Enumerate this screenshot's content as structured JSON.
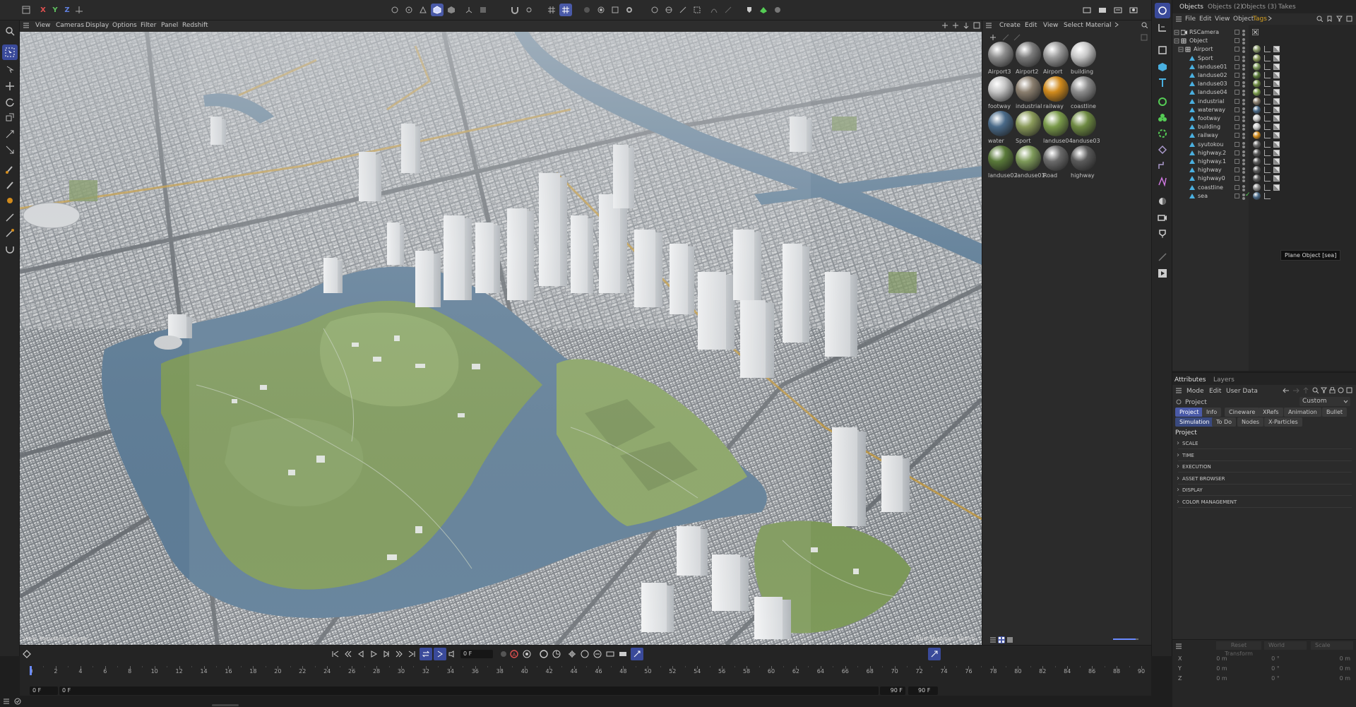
{
  "topbar": {
    "axis_x": "X",
    "axis_y": "Y",
    "axis_z": "Z"
  },
  "viewport": {
    "menu": [
      "View",
      "Cameras",
      "Display",
      "Options",
      "Filter",
      "Panel",
      "Redshift"
    ],
    "label": "View Transform: Scene",
    "grid_spacing": "Grid Spacing : 500 m"
  },
  "material_manager": {
    "menu": [
      "Create",
      "Edit",
      "View",
      "Select",
      "Material"
    ],
    "materials": [
      {
        "name": "Airport3",
        "color": "#8e8e8e"
      },
      {
        "name": "Airport2",
        "color": "#7c7c7c"
      },
      {
        "name": "Airport",
        "color": "#9a9a9a"
      },
      {
        "name": "building",
        "color": "#c8c8c8"
      },
      {
        "name": "footway",
        "color": "#c4c4c4"
      },
      {
        "name": "industrial",
        "color": "#8a7e6e"
      },
      {
        "name": "railway",
        "color": "#d08a1c"
      },
      {
        "name": "coastline",
        "color": "#8c8c8c"
      },
      {
        "name": "water",
        "color": "#4a6a88"
      },
      {
        "name": "Sport",
        "color": "#8a9a5a"
      },
      {
        "name": "landuse04",
        "color": "#7a9a4a"
      },
      {
        "name": "landuse03",
        "color": "#6e8a42"
      },
      {
        "name": "landuse02",
        "color": "#5a7a3a"
      },
      {
        "name": "landuse01",
        "color": "#7e9a5a"
      },
      {
        "name": "Road",
        "color": "#6a6a6a"
      },
      {
        "name": "highway",
        "color": "#5a5a5a"
      }
    ]
  },
  "object_manager": {
    "tabs": [
      "Objects",
      "Objects (2)",
      "Objects (3)",
      "Takes"
    ],
    "menu": [
      "File",
      "Edit",
      "View",
      "Object",
      "Tags"
    ],
    "objects": [
      {
        "name": "RSCamera",
        "indent": 0,
        "tag_color": null
      },
      {
        "name": "Object",
        "indent": 0,
        "tag_color": null
      },
      {
        "name": "Airport",
        "indent": 1,
        "tag_color": "#8a9a6a"
      },
      {
        "name": "Sport",
        "indent": 2,
        "tag_color": "#8a9a5a"
      },
      {
        "name": "landuse01",
        "indent": 2,
        "tag_color": "#7e9a5a"
      },
      {
        "name": "landuse02",
        "indent": 2,
        "tag_color": "#5a7a3a"
      },
      {
        "name": "landuse03",
        "indent": 2,
        "tag_color": "#6e8a42"
      },
      {
        "name": "landuse04",
        "indent": 2,
        "tag_color": "#7a9a4a"
      },
      {
        "name": "industrial",
        "indent": 2,
        "tag_color": "#8a7e6e"
      },
      {
        "name": "waterway",
        "indent": 2,
        "tag_color": "#4a6a88"
      },
      {
        "name": "footway",
        "indent": 2,
        "tag_color": "#c4c4c4"
      },
      {
        "name": "building",
        "indent": 2,
        "tag_color": "#c8c8c8"
      },
      {
        "name": "railway",
        "indent": 2,
        "tag_color": "#d08a1c"
      },
      {
        "name": "syutokou",
        "indent": 2,
        "tag_color": "#6a6a6a"
      },
      {
        "name": "highway.2",
        "indent": 2,
        "tag_color": "#5a5a5a"
      },
      {
        "name": "highway.1",
        "indent": 2,
        "tag_color": "#5a5a5a"
      },
      {
        "name": "highway",
        "indent": 2,
        "tag_color": "#5a5a5a"
      },
      {
        "name": "highway0",
        "indent": 2,
        "tag_color": "#5a5a5a"
      },
      {
        "name": "coastline",
        "indent": 2,
        "tag_color": "#8c8c8c"
      },
      {
        "name": "sea",
        "indent": 2,
        "tag_color": "#4a6a88"
      }
    ],
    "tooltip": "Plane Object [sea]"
  },
  "attributes": {
    "tabs": [
      "Attributes",
      "Layers"
    ],
    "menu": [
      "Mode",
      "Edit",
      "User Data"
    ],
    "object_label": "Project",
    "preset": "Custom",
    "pills_row1": [
      "Project",
      "Info",
      "Cineware",
      "XRefs",
      "Animation",
      "Bullet"
    ],
    "pills_row2": [
      "Simulation",
      "To Do",
      "Nodes",
      "X-Particles"
    ],
    "section_title": "Project",
    "sections": [
      "SCALE",
      "TIME",
      "EXECUTION",
      "ASSET BROWSER",
      "DISPLAY",
      "COLOR MANAGEMENT"
    ]
  },
  "coordinates": {
    "reset": "Reset Transform",
    "space": "World",
    "mode": "Scale",
    "rows": [
      {
        "axis": "X",
        "pos": "0 m",
        "rot": "0 °",
        "scale": "0 m"
      },
      {
        "axis": "Y",
        "pos": "0 m",
        "rot": "0 °",
        "scale": "0 m"
      },
      {
        "axis": "Z",
        "pos": "0 m",
        "rot": "0 °",
        "scale": "0 m"
      }
    ]
  },
  "timeline": {
    "current_frame": "0 F",
    "start": "0 F",
    "min": "0 F",
    "max": "90 F",
    "end": "90 F",
    "ticks": [
      0,
      2,
      4,
      6,
      8,
      10,
      12,
      14,
      16,
      18,
      20,
      22,
      24,
      26,
      28,
      30,
      32,
      34,
      36,
      38,
      40,
      42,
      44,
      46,
      48,
      50,
      52,
      54,
      56,
      58,
      60,
      62,
      64,
      66,
      68,
      70,
      72,
      74,
      76,
      78,
      80,
      82,
      84,
      86,
      88,
      90
    ]
  },
  "colors": {
    "accent": "#4a5aa8",
    "panel": "#2b2b2b",
    "water": "#5f7e98",
    "park": "#7e9a5a"
  }
}
